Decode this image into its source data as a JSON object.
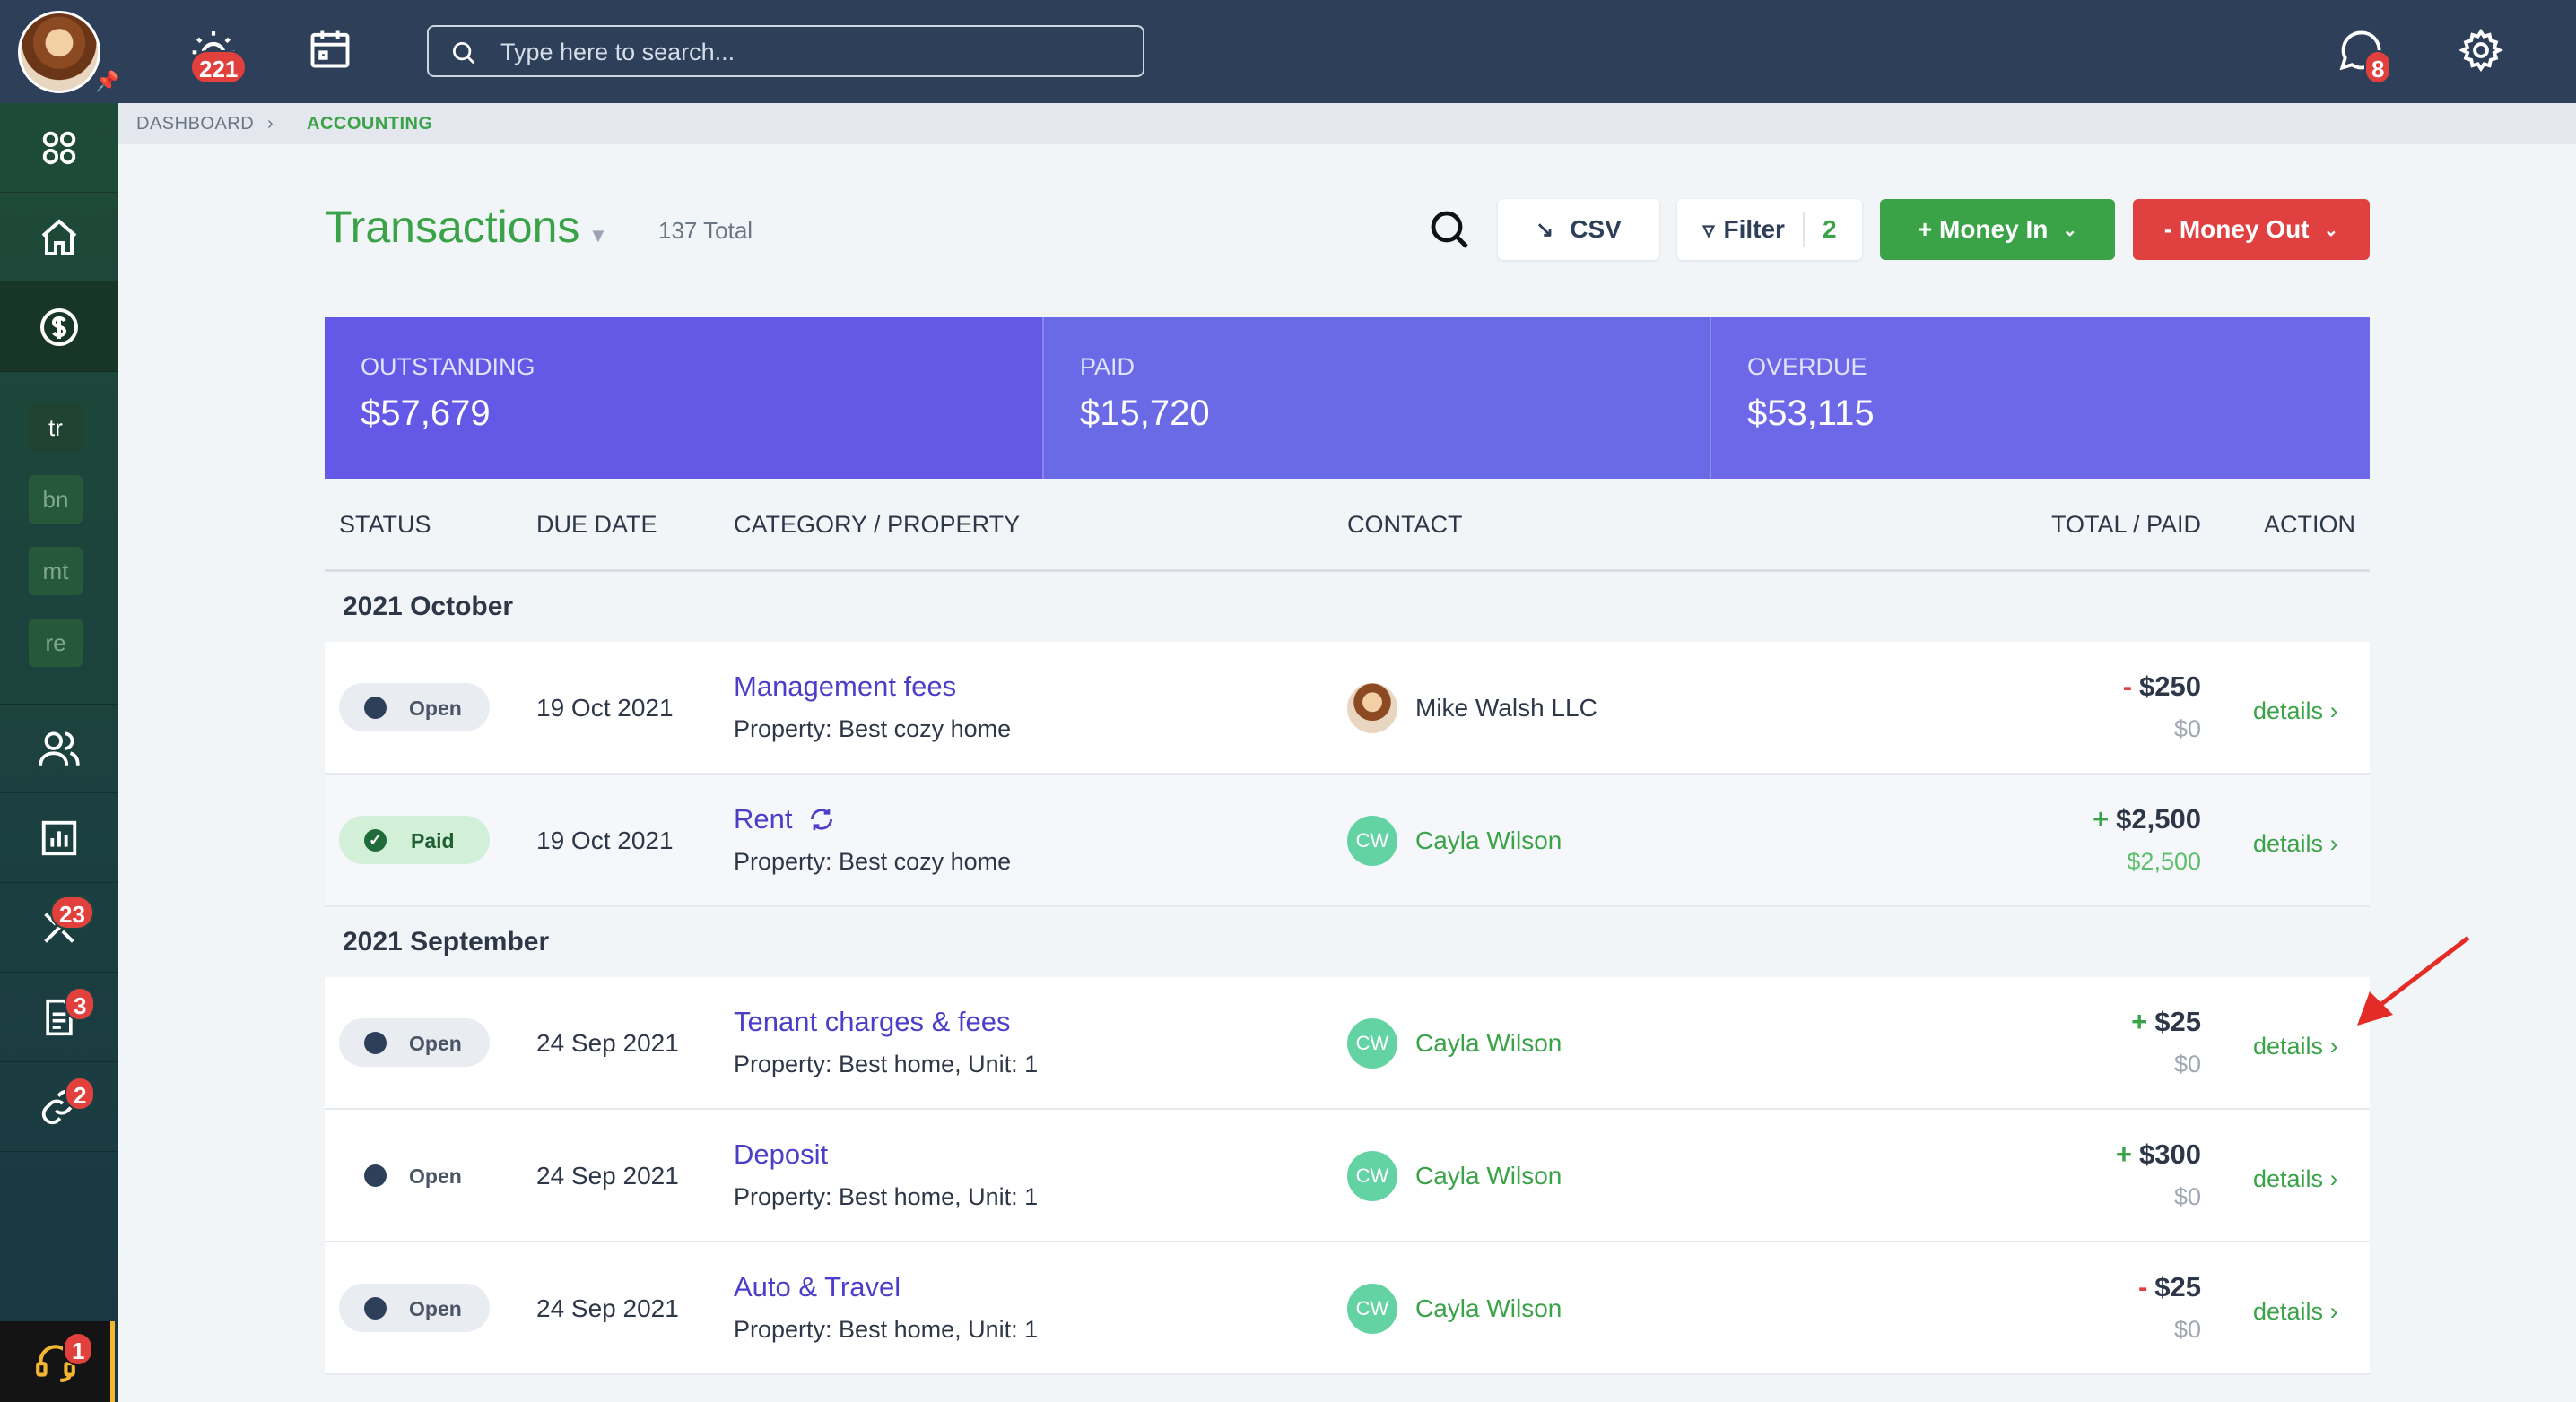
{
  "topbar": {
    "notifications_badge": "221",
    "chat_badge": "8",
    "search_placeholder": "Type here to search..."
  },
  "breadcrumb": {
    "items": [
      "DASHBOARD",
      "ACCOUNTING"
    ]
  },
  "sidebar": {
    "chips": [
      "tr",
      "bn",
      "mt",
      "re"
    ],
    "badges": {
      "maintenance": "23",
      "documents": "3",
      "links": "2",
      "support": "1"
    }
  },
  "header": {
    "title": "Transactions",
    "total": "137 Total",
    "csv_label": "CSV",
    "filter_label": "Filter",
    "filter_count": "2",
    "money_in_label": "+ Money In",
    "money_out_label": "- Money Out"
  },
  "summary": [
    {
      "label": "OUTSTANDING",
      "value": "$57,679",
      "color": "#6359e6"
    },
    {
      "label": "PAID",
      "value": "$15,720",
      "color": "#6a6ae6"
    },
    {
      "label": "OVERDUE",
      "value": "$53,115",
      "color": "#6c68e8"
    }
  ],
  "table": {
    "columns": [
      "STATUS",
      "DUE DATE",
      "CATEGORY / PROPERTY",
      "CONTACT",
      "TOTAL / PAID",
      "ACTION"
    ],
    "groups": [
      {
        "label": "2021 October",
        "rows": [
          {
            "status": "Open",
            "due": "19 Oct 2021",
            "category": "Management fees",
            "property": "Property: Best cozy home",
            "contact": "Mike Walsh LLC",
            "contact_initials": "",
            "sign": "-",
            "total": "$250",
            "paid": "$0",
            "action": "details"
          },
          {
            "status": "Paid",
            "due": "19 Oct 2021",
            "category": "Rent",
            "property": "Property: Best cozy home",
            "contact": "Cayla Wilson",
            "contact_initials": "CW",
            "sign": "+",
            "total": "$2,500",
            "paid": "$2,500",
            "action": "details"
          }
        ]
      },
      {
        "label": "2021 September",
        "rows": [
          {
            "status": "Open",
            "due": "24 Sep 2021",
            "category": "Tenant charges & fees",
            "property": "Property: Best home, Unit: 1",
            "contact": "Cayla Wilson",
            "contact_initials": "CW",
            "sign": "+",
            "total": "$25",
            "paid": "$0",
            "action": "details"
          },
          {
            "status": "Open",
            "due": "24 Sep 2021",
            "category": "Deposit",
            "property": "Property: Best home, Unit: 1",
            "contact": "Cayla Wilson",
            "contact_initials": "CW",
            "sign": "+",
            "total": "$300",
            "paid": "$0",
            "action": "details"
          },
          {
            "status": "Open",
            "due": "24 Sep 2021",
            "category": "Auto & Travel",
            "property": "Property: Best home, Unit: 1",
            "contact": "Cayla Wilson",
            "contact_initials": "CW",
            "sign": "-",
            "total": "$25",
            "paid": "$0",
            "action": "details"
          }
        ]
      }
    ]
  },
  "colors": {
    "green": "#3aa348",
    "red": "#e04040",
    "navy": "#2e3f5a",
    "purple": "#4b3ec9"
  }
}
